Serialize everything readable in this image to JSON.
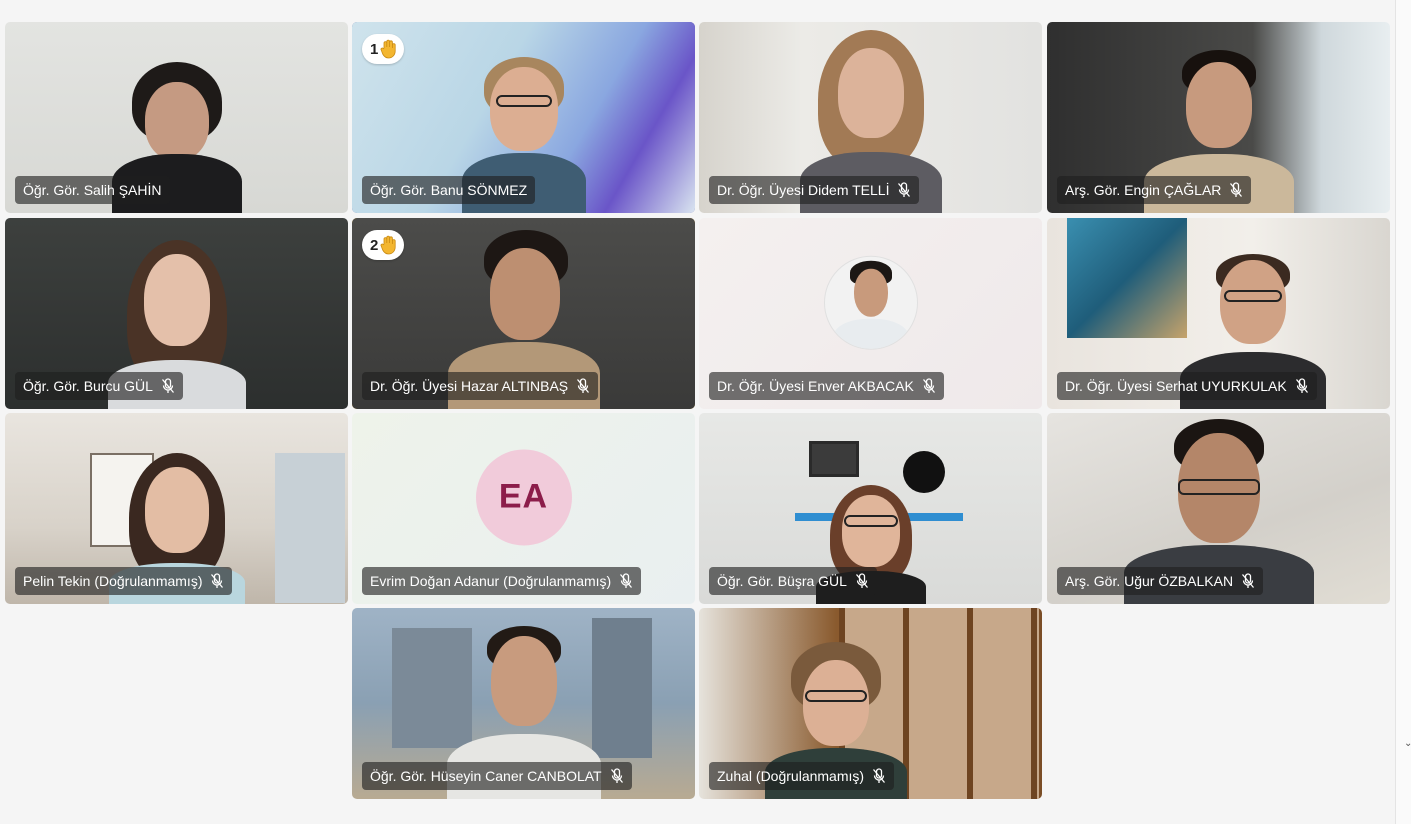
{
  "participants": [
    {
      "name": "Öğr. Gör. Salih ŞAHİN",
      "muted": false
    },
    {
      "name": "Öğr. Gör. Banu SÖNMEZ",
      "muted": false,
      "raised_hand": "1"
    },
    {
      "name": "Dr. Öğr. Üyesi Didem TELLİ",
      "muted": true
    },
    {
      "name": "Arş. Gör. Engin ÇAĞLAR",
      "muted": true
    },
    {
      "name": "Öğr. Gör. Burcu GÜL",
      "muted": true
    },
    {
      "name": "Dr. Öğr. Üyesi Hazar ALTINBAŞ",
      "muted": true,
      "raised_hand": "2"
    },
    {
      "name": "Dr. Öğr. Üyesi Enver AKBACAK",
      "muted": true
    },
    {
      "name": "Dr. Öğr. Üyesi Serhat UYURKULAK",
      "muted": true
    },
    {
      "name": "Pelin Tekin (Doğrulanmamış)",
      "muted": true
    },
    {
      "name": "Evrim Doğan Adanur (Doğrulanmamış)",
      "muted": true,
      "initials": "EA"
    },
    {
      "name": "Öğr. Gör. Büşra GÜL",
      "muted": true
    },
    {
      "name": "Arş. Gör. Uğur ÖZBALKAN",
      "muted": true
    },
    {
      "name": "Öğr. Gör. Hüseyin Caner CANBOLAT",
      "muted": true
    },
    {
      "name": "Zuhal (Doğrulanmamış)",
      "muted": true
    }
  ],
  "icons": {
    "mic_off": "mic-off-icon",
    "raised_hand": "raised-hand-icon"
  },
  "colors": {
    "hand_raise_1_border": "#6264a7",
    "hand_raise_2_border": "#e0a627",
    "name_pill_bg": "#1e1e1e",
    "initials_bg": "#f1cbda",
    "initials_fg": "#8c1d4a"
  }
}
